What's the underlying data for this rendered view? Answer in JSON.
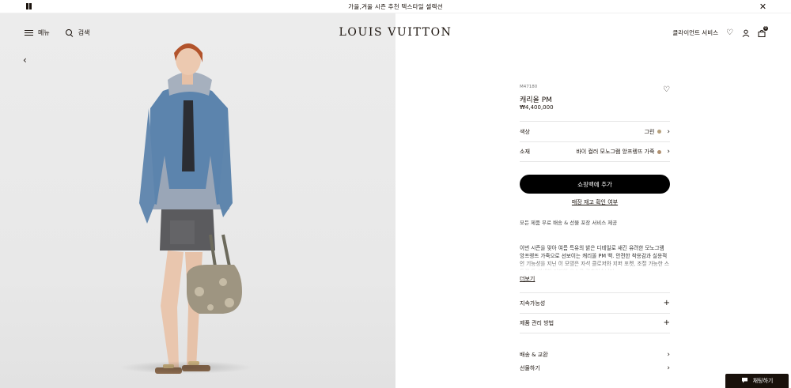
{
  "announcement": {
    "text": "가을,겨울 시즌 추천 텍스타일 셀렉션"
  },
  "header": {
    "menu_label": "메뉴",
    "search_label": "검색",
    "logo": "LOUIS VUITTON",
    "client_services": "클라이언트 서비스",
    "bag_count": "0"
  },
  "product": {
    "sku": "M47180",
    "name": "캐리올 PM",
    "price": "₩4,400,000",
    "color_label": "색상",
    "color_value": "그린",
    "color_swatch": "#b6a07c",
    "material_label": "소재",
    "material_value": "바이 컬러 모노그램 앙프렝뜨 가죽",
    "material_swatch": "#b09070",
    "add_to_bag": "쇼핑백에 추가",
    "store_stock": "매장 재고 확인 여부",
    "perks": "모든 제품 무료 배송 & 선물 포장 서비스 제공",
    "description": "이번 시즌을 맞아 여름 특유의 밝은 디테일로 새긴 유려한 모노그램 앙프렝뜨 가죽으로 선보이는 캐리올 PM 백. 안전한 착용감과 실용적인 기능성을 지닌 이 모델은 자석 클로저와 지퍼 포켓, 조절 가능한 스트랩 등 섬세한 디자인 요소를 갖추었습니다.",
    "more": "더보기",
    "accordion": [
      "지속가능성",
      "제품 관리 방법"
    ],
    "footer_links": [
      "배송 & 교환",
      "선물하기"
    ]
  },
  "chat": {
    "label": "채팅하기"
  },
  "icons": [
    "pause-icon",
    "close-icon",
    "menu-icon",
    "search-icon",
    "heart-icon",
    "account-icon",
    "bag-icon",
    "back-arrow-icon",
    "chat-icon"
  ]
}
